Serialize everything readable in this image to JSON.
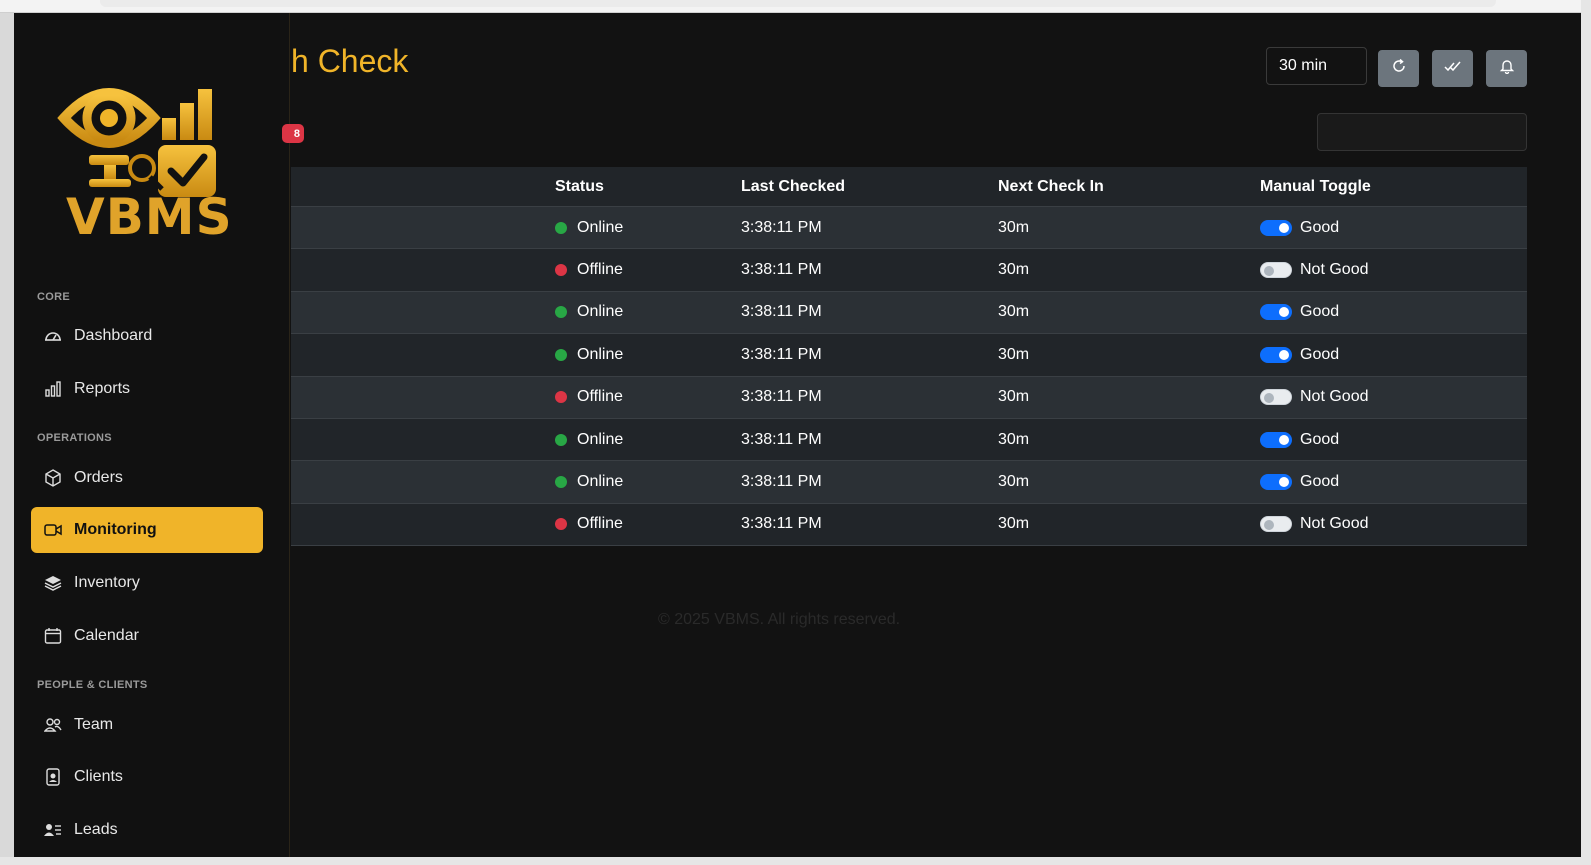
{
  "page": {
    "title_visible": "h Check",
    "count_badge": "8",
    "interval": "30 min",
    "footer": "© 2025 VBMS. All rights reserved."
  },
  "brand": {
    "name": "VBMS",
    "accent": "#f0b429"
  },
  "sidebar": {
    "sections": [
      {
        "label": "CORE"
      },
      {
        "label": "OPERATIONS"
      },
      {
        "label": "PEOPLE & CLIENTS"
      }
    ],
    "items": [
      {
        "label": "Dashboard",
        "icon": "speedometer-icon"
      },
      {
        "label": "Reports",
        "icon": "bar-chart-icon"
      },
      {
        "label": "Orders",
        "icon": "box-icon"
      },
      {
        "label": "Monitoring",
        "icon": "camera-video-icon",
        "active": true
      },
      {
        "label": "Inventory",
        "icon": "layers-icon"
      },
      {
        "label": "Calendar",
        "icon": "calendar-icon"
      },
      {
        "label": "Team",
        "icon": "people-icon"
      },
      {
        "label": "Clients",
        "icon": "person-badge-icon"
      },
      {
        "label": "Leads",
        "icon": "person-lines-icon"
      }
    ]
  },
  "toolbar": {
    "refresh_icon": "refresh-icon",
    "check_all_icon": "check-all-icon",
    "bell_icon": "bell-icon"
  },
  "table": {
    "columns": [
      "Status",
      "Last Checked",
      "Next Check In",
      "Manual Toggle"
    ],
    "rows": [
      {
        "status": "Online",
        "last": "3:38:11 PM",
        "next": "30m",
        "toggle": "Good",
        "on": true
      },
      {
        "status": "Offline",
        "last": "3:38:11 PM",
        "next": "30m",
        "toggle": "Not Good",
        "on": false
      },
      {
        "status": "Online",
        "last": "3:38:11 PM",
        "next": "30m",
        "toggle": "Good",
        "on": true
      },
      {
        "status": "Online",
        "last": "3:38:11 PM",
        "next": "30m",
        "toggle": "Good",
        "on": true
      },
      {
        "status": "Offline",
        "last": "3:38:11 PM",
        "next": "30m",
        "toggle": "Not Good",
        "on": false
      },
      {
        "status": "Online",
        "last": "3:38:11 PM",
        "next": "30m",
        "toggle": "Good",
        "on": true
      },
      {
        "status": "Online",
        "last": "3:38:11 PM",
        "next": "30m",
        "toggle": "Good",
        "on": true
      },
      {
        "status": "Offline",
        "last": "3:38:11 PM",
        "next": "30m",
        "toggle": "Not Good",
        "on": false
      }
    ],
    "online_color": "#28a745",
    "offline_color": "#dc3545"
  }
}
